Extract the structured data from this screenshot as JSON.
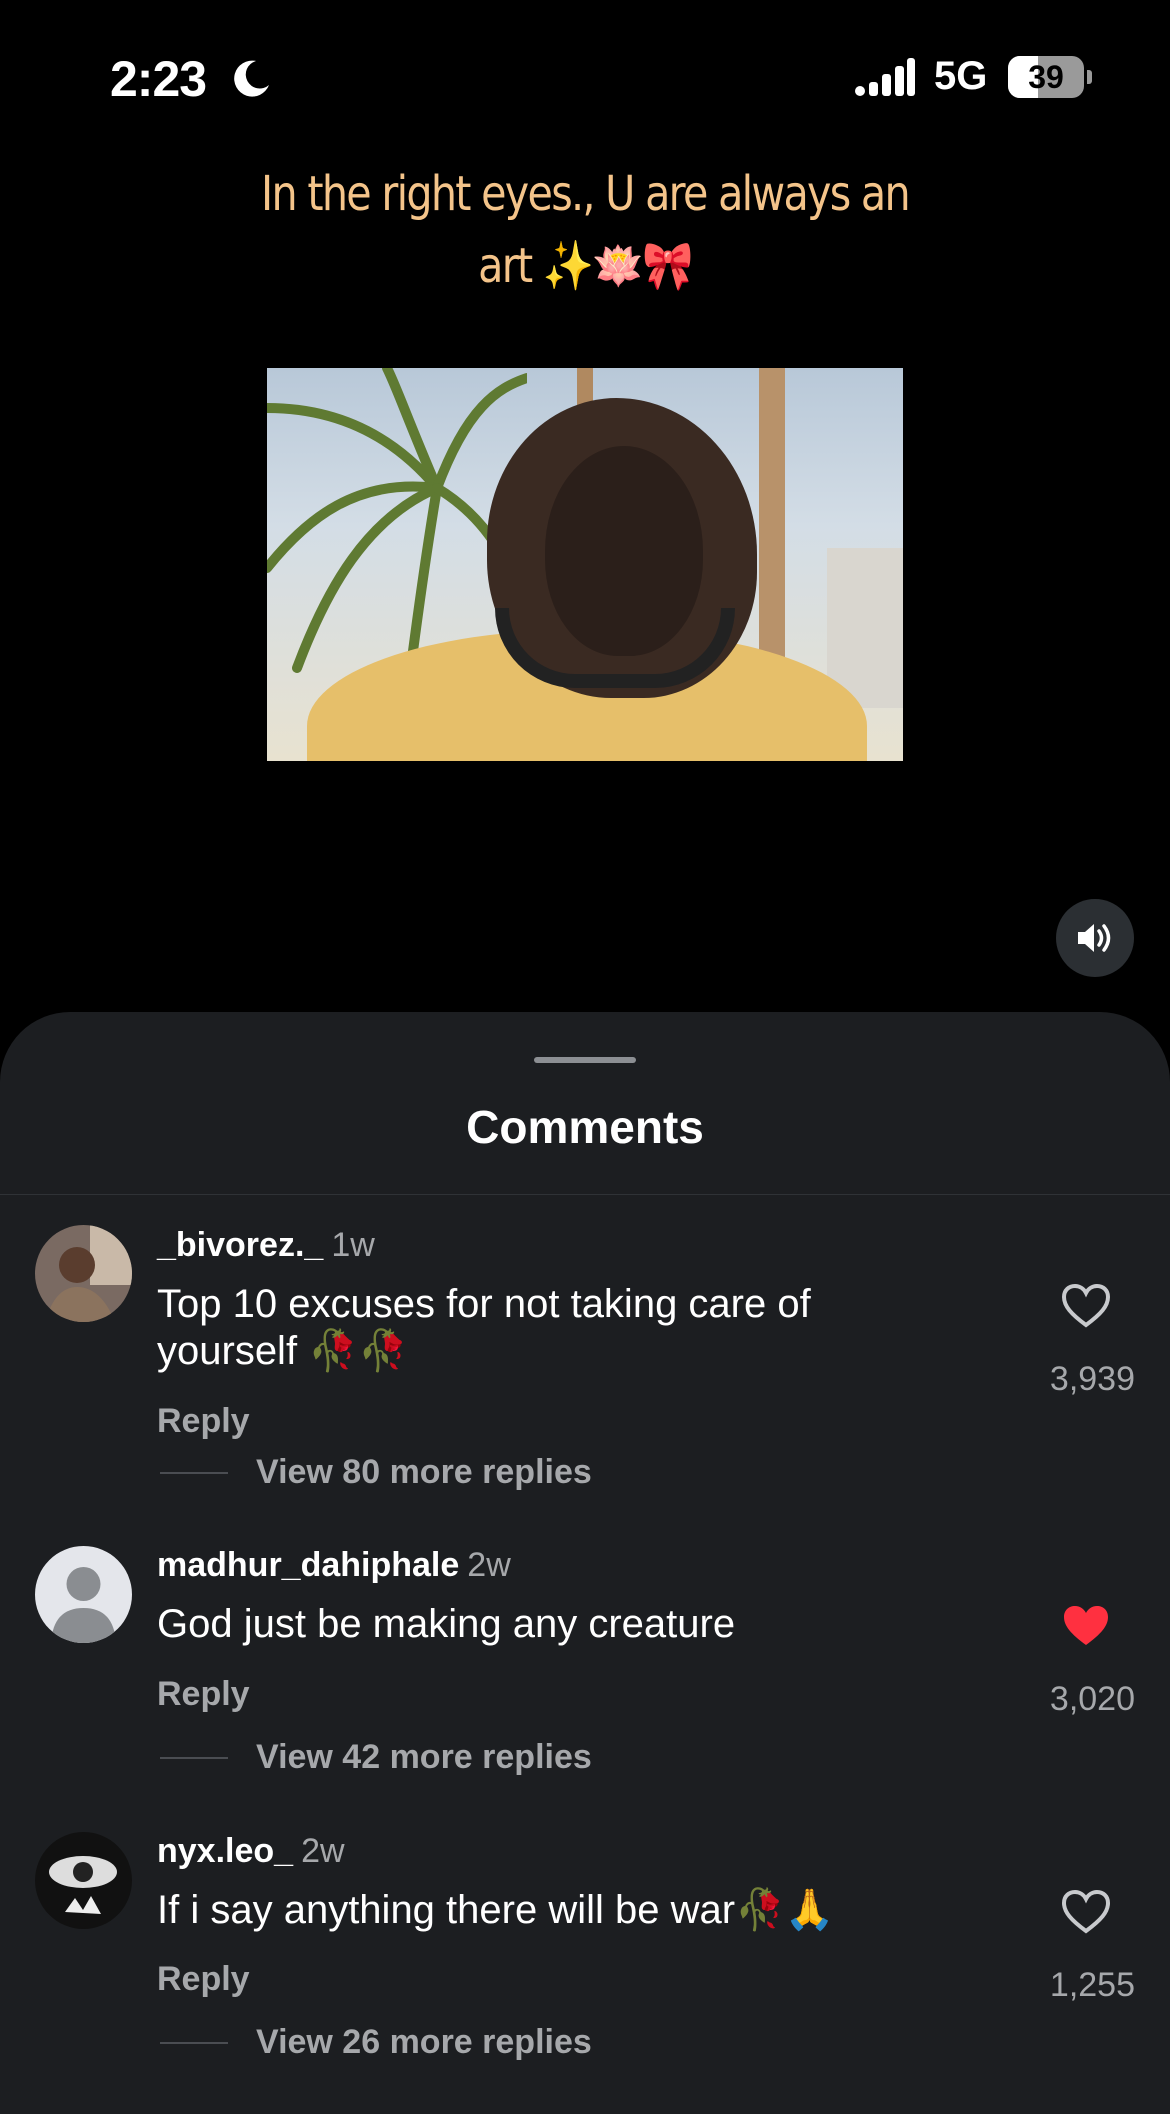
{
  "status_bar": {
    "time": "2:23",
    "network": "5G",
    "battery": "39",
    "battery_level": 0.39
  },
  "post": {
    "caption": "In the right eyes., U are always an art ✨🪷🎀"
  },
  "sheet": {
    "title": "Comments"
  },
  "comments": [
    {
      "username": "_bivorez._",
      "time": "1w",
      "text": "Top 10 excuses for not taking care of yourself 🥀🥀",
      "reply_label": "Reply",
      "view_replies": "View 80 more replies",
      "likes": "3,939",
      "liked": false
    },
    {
      "username": "madhur_dahiphale",
      "time": "2w",
      "text": "God just be making any creature",
      "reply_label": "Reply",
      "view_replies": "View 42 more replies",
      "likes": "3,020",
      "liked": true
    },
    {
      "username": "nyx.leo_",
      "time": "2w",
      "text": "If i say anything there will be war🥀🙏",
      "reply_label": "Reply",
      "view_replies": "View 26 more replies",
      "likes": "1,255",
      "liked": false
    }
  ],
  "colors": {
    "liked_heart": "#ff3040",
    "caption": "#f4c48a",
    "sheet_bg": "#1c1e21"
  }
}
